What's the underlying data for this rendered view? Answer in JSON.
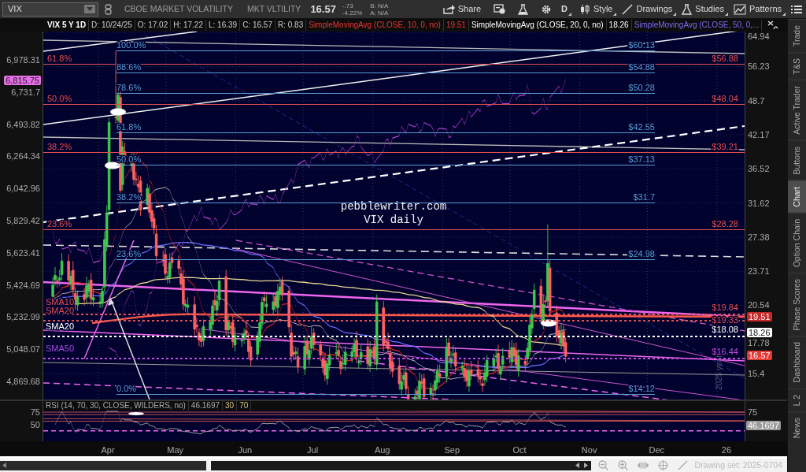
{
  "toolbar": {
    "symbol": "VIX",
    "description": "CBOE MARKET VOLATILITY",
    "short_name": "MKT VLTILITY",
    "last": "16.57",
    "change": "-.73",
    "change_percent": "-4.22%",
    "bid": "B: N/A",
    "ask": "A: N/A",
    "buttons": [
      {
        "kind": "share",
        "label": "Share"
      },
      {
        "kind": "alert"
      },
      {
        "kind": "flask"
      },
      {
        "kind": "gear"
      },
      {
        "kind": "period",
        "label": "D"
      },
      {
        "kind": "style",
        "label": "Style"
      },
      {
        "kind": "drawings",
        "label": "Drawings"
      },
      {
        "kind": "studies",
        "label": "Studies"
      },
      {
        "kind": "patterns",
        "label": "Patterns"
      },
      {
        "kind": "menu"
      }
    ]
  },
  "chart_header": {
    "title": "VIX 5 Y 1D",
    "fields": [
      "D: 10/24/25",
      "O: 17.02",
      "H: 17.22",
      "L: 16.39",
      "C: 16.57",
      "R: 0.83"
    ],
    "studies": [
      {
        "label": "SimpleMovingAvg (CLOSE, 10, 0, no)",
        "value": "19.51",
        "color": "#e53935"
      },
      {
        "label": "SimpleMovingAvg (CLOSE, 20, 0, no)",
        "value": "18.26",
        "color": "#ffffff"
      },
      {
        "label": "SimpleMovingAvg (CLOSE, 50, 0,...",
        "color": "#7b6cf0"
      }
    ]
  },
  "left_axis": {
    "ticks": [
      "6,978.31",
      "6,731.7",
      "6,493.82",
      "6,264.34",
      "6,042.96",
      "5,829.42",
      "5,623.41",
      "5,424.69",
      "5,232.99",
      "5,048.07",
      "4,869.68"
    ],
    "marker": "6,815.75"
  },
  "right_axis": {
    "ticks": [
      "64.94",
      "56.23",
      "48.7",
      "42.17",
      "36.52",
      "31.62",
      "27.38",
      "23.71",
      "20.54",
      "17.78",
      "15.4"
    ],
    "markers": [
      {
        "value": "19.51",
        "color": "#c62828"
      },
      {
        "value": "18.26",
        "color": "#ffffff"
      },
      {
        "value": "16.57",
        "color": "#e53935"
      }
    ]
  },
  "chart_text": {
    "title": "pebblewriter.com",
    "subtitle": "VIX daily",
    "year_note": "2025 year"
  },
  "fib_levels": [
    {
      "kind": "short",
      "percent": "100.0%",
      "price": "$60.13",
      "color": "#5b9bd5"
    },
    {
      "kind": "long",
      "percent": "61.8%",
      "price": "$56.88",
      "color": "#e0504f"
    },
    {
      "kind": "short",
      "percent": "88.6%",
      "price": "$54.88",
      "color": "#5b9bd5"
    },
    {
      "kind": "short",
      "percent": "78.6%",
      "price": "$50.28",
      "color": "#5b9bd5"
    },
    {
      "kind": "long",
      "percent": "50.0%",
      "price": "$48.04",
      "color": "#e0504f"
    },
    {
      "kind": "short",
      "percent": "61.8%",
      "price": "$42.55",
      "color": "#5b9bd5"
    },
    {
      "kind": "long",
      "percent": "38.2%",
      "price": "$39.21",
      "color": "#e0504f"
    },
    {
      "kind": "short",
      "percent": "50.0%",
      "price": "$37.13",
      "color": "#5b9bd5"
    },
    {
      "kind": "short",
      "percent": "38.2%",
      "price": "$31.7",
      "color": "#5b9bd5"
    },
    {
      "kind": "long",
      "percent": "23.6%",
      "price": "$28.28",
      "color": "#e0504f"
    },
    {
      "kind": "short",
      "percent": "23.6%",
      "price": "$24.98",
      "color": "#5b9bd5"
    },
    {
      "kind": "short",
      "percent": "0.0%",
      "price": "$14.12",
      "color": "#5b9bd5"
    }
  ],
  "price_levels": [
    {
      "price": "$19.84",
      "color": "#e0504f"
    },
    {
      "price": "$19.33",
      "color": "#e0504f"
    },
    {
      "price": "$18.08",
      "color": "#ffffff"
    },
    {
      "price": "$16.44",
      "color": "#c04ce0"
    }
  ],
  "sma_labels": [
    {
      "label": "SMA10",
      "color": "#e0504f"
    },
    {
      "label": "SMA20",
      "color": "#e0504f"
    },
    {
      "label": "SMA20",
      "color": "#ffffff"
    },
    {
      "label": "SMA50",
      "color": "#a44ce0"
    }
  ],
  "rsi": {
    "label": "RSI (14, 70, 30, CLOSE, WILDERS, no)",
    "value": "46.1697",
    "levels": [
      "30",
      "70"
    ],
    "left_ticks": [
      "75",
      "50"
    ],
    "right_tick": "75",
    "marker": "46.1697"
  },
  "x_axis": [
    "Apr",
    "May",
    "Jun",
    "Jul",
    "Aug",
    "Sep",
    "Oct",
    "Nov",
    "Dec",
    "26"
  ],
  "bottom_bar": {
    "drawing_set": "Drawing set: 2025-0704"
  },
  "side_tabs": [
    {
      "label": "Trade",
      "selected": false
    },
    {
      "label": "T&S",
      "selected": false
    },
    {
      "label": "Active Trader",
      "selected": false
    },
    {
      "label": "Buttons",
      "selected": false
    },
    {
      "label": "Chart",
      "selected": true
    },
    {
      "label": "Option Chain",
      "selected": false
    },
    {
      "label": "Phase Scores",
      "selected": false
    },
    {
      "label": "Dashboard",
      "selected": false
    },
    {
      "label": "L 2",
      "selected": false
    },
    {
      "label": "News",
      "selected": false
    }
  ]
}
